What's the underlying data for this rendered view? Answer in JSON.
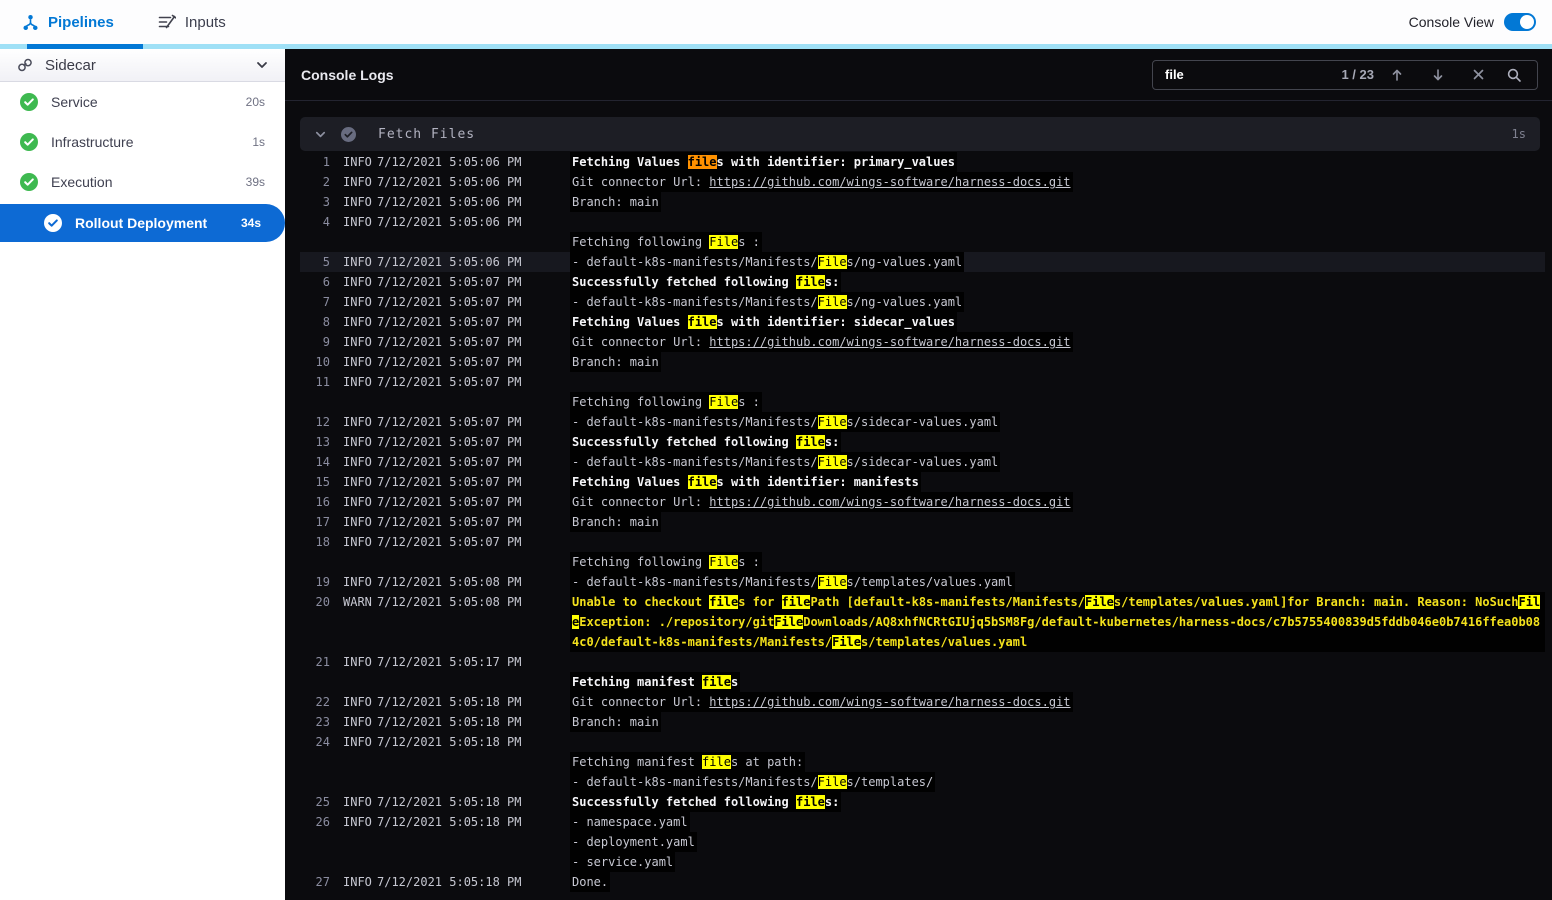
{
  "topnav": {
    "tabs": [
      {
        "label": "Pipelines"
      },
      {
        "label": "Inputs"
      }
    ],
    "console_view_label": "Console View",
    "toggle_on": true
  },
  "sidebar": {
    "title": "Sidecar",
    "items": [
      {
        "label": "Service",
        "duration": "20s",
        "status": "success"
      },
      {
        "label": "Infrastructure",
        "duration": "1s",
        "status": "success"
      },
      {
        "label": "Execution",
        "duration": "39s",
        "status": "success"
      },
      {
        "label": "Rollout Deployment",
        "duration": "34s",
        "status": "selected"
      }
    ]
  },
  "colors": {
    "accent": "#0278d5",
    "success_green": "#3eb950",
    "selected_blue": "#0d6ad4",
    "warn_yellow": "#f3e11c",
    "match_highlight": "#ffff00",
    "active_match_highlight": "#ff9100",
    "console_bg": "#0b0b0e"
  },
  "console": {
    "title": "Console Logs",
    "search": {
      "value": "file",
      "counter": "1 / 23"
    },
    "section": {
      "title": "Fetch Files",
      "duration": "1s"
    },
    "logs": [
      {
        "n": "1",
        "level": "INFO",
        "ts": "7/12/2021 5:05:06 PM",
        "lines": [
          [
            {
              "t": "Fetching Values ",
              "b": 1
            },
            {
              "t": "file",
              "b": 1,
              "h": "a"
            },
            {
              "t": "s with identifier: primary_values",
              "b": 1
            }
          ]
        ]
      },
      {
        "n": "2",
        "level": "INFO",
        "ts": "7/12/2021 5:05:06 PM",
        "lines": [
          [
            {
              "t": "Git connector Url: "
            },
            {
              "t": "https://github.com/wings-software/harness-docs.git",
              "u": 1
            }
          ]
        ]
      },
      {
        "n": "3",
        "level": "INFO",
        "ts": "7/12/2021 5:05:06 PM",
        "lines": [
          [
            {
              "t": "Branch: main"
            }
          ]
        ]
      },
      {
        "n": "4",
        "level": "INFO",
        "ts": "7/12/2021 5:05:06 PM",
        "lines": [
          [],
          [
            {
              "t": "Fetching following "
            },
            {
              "t": "File",
              "h": "m"
            },
            {
              "t": "s :"
            }
          ]
        ]
      },
      {
        "n": "5",
        "level": "INFO",
        "ts": "7/12/2021 5:05:06 PM",
        "hl": 1,
        "lines": [
          [
            {
              "t": "- default-k8s-manifests/Manifests/"
            },
            {
              "t": "File",
              "h": "m"
            },
            {
              "t": "s/ng-values.yaml"
            }
          ]
        ]
      },
      {
        "n": "6",
        "level": "INFO",
        "ts": "7/12/2021 5:05:07 PM",
        "lines": [
          [
            {
              "t": "Successfully fetched following ",
              "b": 1
            },
            {
              "t": "file",
              "b": 1,
              "h": "m"
            },
            {
              "t": "s:",
              "b": 1
            }
          ]
        ]
      },
      {
        "n": "7",
        "level": "INFO",
        "ts": "7/12/2021 5:05:07 PM",
        "lines": [
          [
            {
              "t": "- default-k8s-manifests/Manifests/"
            },
            {
              "t": "File",
              "h": "m"
            },
            {
              "t": "s/ng-values.yaml"
            }
          ]
        ]
      },
      {
        "n": "8",
        "level": "INFO",
        "ts": "7/12/2021 5:05:07 PM",
        "lines": [
          [
            {
              "t": "Fetching Values ",
              "b": 1
            },
            {
              "t": "file",
              "b": 1,
              "h": "m"
            },
            {
              "t": "s with identifier: sidecar_values",
              "b": 1
            }
          ]
        ]
      },
      {
        "n": "9",
        "level": "INFO",
        "ts": "7/12/2021 5:05:07 PM",
        "lines": [
          [
            {
              "t": "Git connector Url: "
            },
            {
              "t": "https://github.com/wings-software/harness-docs.git",
              "u": 1
            }
          ]
        ]
      },
      {
        "n": "10",
        "level": "INFO",
        "ts": "7/12/2021 5:05:07 PM",
        "lines": [
          [
            {
              "t": "Branch: main"
            }
          ]
        ]
      },
      {
        "n": "11",
        "level": "INFO",
        "ts": "7/12/2021 5:05:07 PM",
        "lines": [
          [],
          [
            {
              "t": "Fetching following "
            },
            {
              "t": "File",
              "h": "m"
            },
            {
              "t": "s :"
            }
          ]
        ]
      },
      {
        "n": "12",
        "level": "INFO",
        "ts": "7/12/2021 5:05:07 PM",
        "lines": [
          [
            {
              "t": "- default-k8s-manifests/Manifests/"
            },
            {
              "t": "File",
              "h": "m"
            },
            {
              "t": "s/sidecar-values.yaml"
            }
          ]
        ]
      },
      {
        "n": "13",
        "level": "INFO",
        "ts": "7/12/2021 5:05:07 PM",
        "lines": [
          [
            {
              "t": "Successfully fetched following ",
              "b": 1
            },
            {
              "t": "file",
              "b": 1,
              "h": "m"
            },
            {
              "t": "s:",
              "b": 1
            }
          ]
        ]
      },
      {
        "n": "14",
        "level": "INFO",
        "ts": "7/12/2021 5:05:07 PM",
        "lines": [
          [
            {
              "t": "- default-k8s-manifests/Manifests/"
            },
            {
              "t": "File",
              "h": "m"
            },
            {
              "t": "s/sidecar-values.yaml"
            }
          ]
        ]
      },
      {
        "n": "15",
        "level": "INFO",
        "ts": "7/12/2021 5:05:07 PM",
        "lines": [
          [
            {
              "t": "Fetching Values ",
              "b": 1
            },
            {
              "t": "file",
              "b": 1,
              "h": "m"
            },
            {
              "t": "s with identifier: manifests",
              "b": 1
            }
          ]
        ]
      },
      {
        "n": "16",
        "level": "INFO",
        "ts": "7/12/2021 5:05:07 PM",
        "lines": [
          [
            {
              "t": "Git connector Url: "
            },
            {
              "t": "https://github.com/wings-software/harness-docs.git",
              "u": 1
            }
          ]
        ]
      },
      {
        "n": "17",
        "level": "INFO",
        "ts": "7/12/2021 5:05:07 PM",
        "lines": [
          [
            {
              "t": "Branch: main"
            }
          ]
        ]
      },
      {
        "n": "18",
        "level": "INFO",
        "ts": "7/12/2021 5:05:07 PM",
        "lines": [
          [],
          [
            {
              "t": "Fetching following "
            },
            {
              "t": "File",
              "h": "m"
            },
            {
              "t": "s :"
            }
          ]
        ]
      },
      {
        "n": "19",
        "level": "INFO",
        "ts": "7/12/2021 5:05:08 PM",
        "lines": [
          [
            {
              "t": "- default-k8s-manifests/Manifests/"
            },
            {
              "t": "File",
              "h": "m"
            },
            {
              "t": "s/templates/values.yaml"
            }
          ]
        ]
      },
      {
        "n": "20",
        "level": "WARN",
        "ts": "7/12/2021 5:05:08 PM",
        "lines": [
          [
            {
              "t": "Unable to checkout ",
              "w": 1
            },
            {
              "t": "file",
              "w": 1,
              "h": "m"
            },
            {
              "t": "s for ",
              "w": 1
            },
            {
              "t": "file",
              "w": 1,
              "h": "m"
            },
            {
              "t": "Path [default-k8s-manifests/Manifests/",
              "w": 1
            },
            {
              "t": "File",
              "w": 1,
              "h": "m"
            },
            {
              "t": "s/templates/values.yaml]for Branch: main. Reason: NoSuch",
              "w": 1
            },
            {
              "t": "File",
              "w": 1,
              "h": "m"
            },
            {
              "t": "Exception: ./repository/git",
              "w": 1
            },
            {
              "t": "File",
              "w": 1,
              "h": "m"
            },
            {
              "t": "Downloads/AQ8xhfNCRtGIUjq5bSM8Fg/default-kubernetes/harness-docs/c7b5755400839d5fddb046e0b7416ffea0b084c0/default-k8s-manifests/Manifests/",
              "w": 1
            },
            {
              "t": "File",
              "w": 1,
              "h": "m"
            },
            {
              "t": "s/templates/values.yaml",
              "w": 1
            }
          ]
        ]
      },
      {
        "n": "21",
        "level": "INFO",
        "ts": "7/12/2021 5:05:17 PM",
        "lines": [
          [],
          [
            {
              "t": "Fetching manifest ",
              "b": 1
            },
            {
              "t": "file",
              "b": 1,
              "h": "m"
            },
            {
              "t": "s",
              "b": 1
            }
          ]
        ]
      },
      {
        "n": "22",
        "level": "INFO",
        "ts": "7/12/2021 5:05:18 PM",
        "lines": [
          [
            {
              "t": "Git connector Url: "
            },
            {
              "t": "https://github.com/wings-software/harness-docs.git",
              "u": 1
            }
          ]
        ]
      },
      {
        "n": "23",
        "level": "INFO",
        "ts": "7/12/2021 5:05:18 PM",
        "lines": [
          [
            {
              "t": "Branch: main"
            }
          ]
        ]
      },
      {
        "n": "24",
        "level": "INFO",
        "ts": "7/12/2021 5:05:18 PM",
        "lines": [
          [],
          [
            {
              "t": "Fetching manifest "
            },
            {
              "t": "file",
              "h": "m"
            },
            {
              "t": "s at path:"
            }
          ],
          [
            {
              "t": "- default-k8s-manifests/Manifests/"
            },
            {
              "t": "File",
              "h": "m"
            },
            {
              "t": "s/templates/"
            }
          ]
        ]
      },
      {
        "n": "25",
        "level": "INFO",
        "ts": "7/12/2021 5:05:18 PM",
        "lines": [
          [
            {
              "t": "Successfully fetched following ",
              "b": 1
            },
            {
              "t": "file",
              "b": 1,
              "h": "m"
            },
            {
              "t": "s:",
              "b": 1
            }
          ]
        ]
      },
      {
        "n": "26",
        "level": "INFO",
        "ts": "7/12/2021 5:05:18 PM",
        "lines": [
          [
            {
              "t": "- namespace.yaml"
            }
          ],
          [
            {
              "t": "- deployment.yaml"
            }
          ],
          [
            {
              "t": "- service.yaml"
            }
          ]
        ]
      },
      {
        "n": "27",
        "level": "INFO",
        "ts": "7/12/2021 5:05:18 PM",
        "lines": [
          [
            {
              "t": "Done."
            }
          ]
        ]
      }
    ]
  }
}
